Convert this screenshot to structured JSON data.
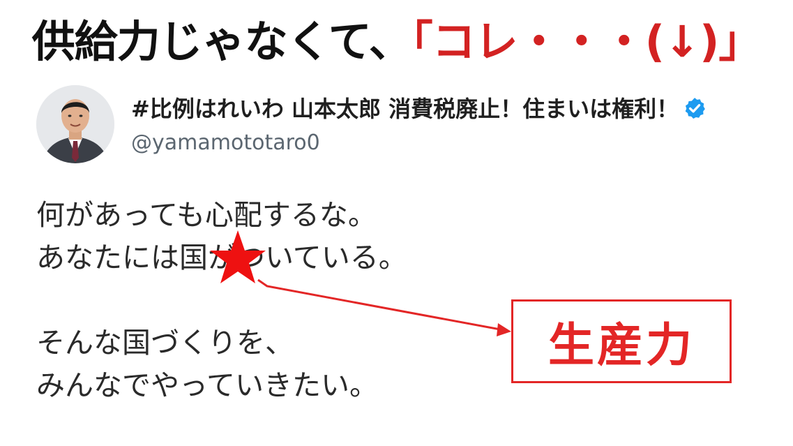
{
  "headline": {
    "black_text": "供給力じゃなくて、",
    "red_text": "「コレ・・・(↓)」",
    "black_color": "#111111",
    "red_color": "#d32222"
  },
  "tweet": {
    "display_name": "#比例はれいわ 山本太郎 消費税廃止！住まいは権利！",
    "handle": "@yamamototaro0",
    "verified_icon": "verified-badge-icon",
    "verified_color": "#1d9bf0",
    "lines": [
      "何があっても心配するな。",
      "あなたには国がついている。",
      "",
      "そんな国づくりを、",
      "みんなでやっていきたい。"
    ]
  },
  "annotation": {
    "marker_icon": "red-star-icon",
    "callout_text": "生産力",
    "color": "#e32626"
  }
}
